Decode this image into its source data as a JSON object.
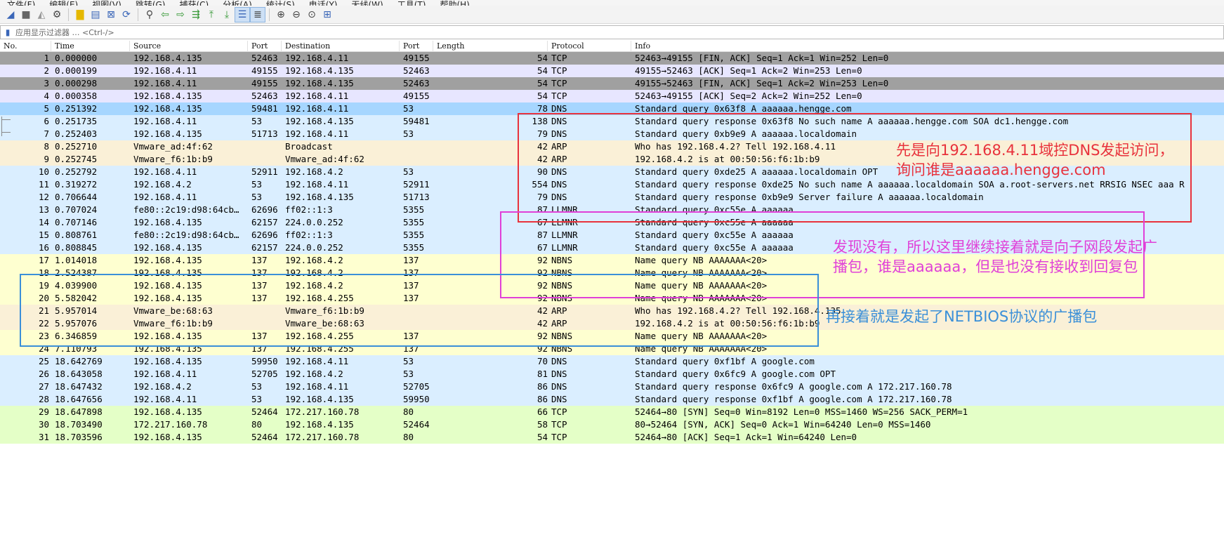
{
  "menubar": {
    "items": [
      "文件(F)",
      "编辑(E)",
      "视图(V)",
      "跳转(G)",
      "捕获(C)",
      "分析(A)",
      "统计(S)",
      "电话(Y)",
      "无线(W)",
      "工具(T)",
      "帮助(H)"
    ]
  },
  "toolbar": {
    "icons": [
      "shark-fin-start-icon",
      "stop-square-icon",
      "restart-fin-icon",
      "options-gear-icon",
      "open-folder-icon",
      "save-file-icon",
      "close-file-icon",
      "reload-icon",
      "find-packet-icon",
      "go-back-icon",
      "go-forward-icon",
      "go-to-packet-icon",
      "go-first-icon",
      "go-last-icon",
      "autoscroll-icon",
      "colorize-icon",
      "zoom-in-icon",
      "zoom-out-icon",
      "zoom-normal-icon",
      "resize-columns-icon"
    ]
  },
  "filter": {
    "placeholder": "应用显示过滤器 … <Ctrl-/>"
  },
  "columns": {
    "no": "No.",
    "time": "Time",
    "source": "Source",
    "sport": "Port",
    "destination": "Destination",
    "dport": "Port",
    "length_label": "Length",
    "protocol": "Protocol",
    "info": "Info"
  },
  "packets": [
    {
      "no": "1",
      "time": "0.000000",
      "src": "192.168.4.135",
      "sport": "52463",
      "dst": "192.168.4.11",
      "dport": "49155",
      "len": "54",
      "proto": "TCP",
      "info": "52463→49155 [FIN, ACK] Seq=1 Ack=1 Win=252 Len=0"
    },
    {
      "no": "2",
      "time": "0.000199",
      "src": "192.168.4.11",
      "sport": "49155",
      "dst": "192.168.4.135",
      "dport": "52463",
      "len": "54",
      "proto": "TCP",
      "info": "49155→52463 [ACK] Seq=1 Ack=2 Win=253 Len=0"
    },
    {
      "no": "3",
      "time": "0.000298",
      "src": "192.168.4.11",
      "sport": "49155",
      "dst": "192.168.4.135",
      "dport": "52463",
      "len": "54",
      "proto": "TCP",
      "info": "49155→52463 [FIN, ACK] Seq=1 Ack=2 Win=253 Len=0"
    },
    {
      "no": "4",
      "time": "0.000358",
      "src": "192.168.4.135",
      "sport": "52463",
      "dst": "192.168.4.11",
      "dport": "49155",
      "len": "54",
      "proto": "TCP",
      "info": "52463→49155 [ACK] Seq=2 Ack=2 Win=252 Len=0"
    },
    {
      "no": "5",
      "time": "0.251392",
      "src": "192.168.4.135",
      "sport": "59481",
      "dst": "192.168.4.11",
      "dport": "53",
      "len": "78",
      "proto": "DNS",
      "info": "Standard query 0x63f8 A aaaaaa.hengge.com"
    },
    {
      "no": "6",
      "time": "0.251735",
      "src": "192.168.4.11",
      "sport": "53",
      "dst": "192.168.4.135",
      "dport": "59481",
      "len": "138",
      "proto": "DNS",
      "info": "Standard query response 0x63f8 No such name A aaaaaa.hengge.com SOA dc1.hengge.com"
    },
    {
      "no": "7",
      "time": "0.252403",
      "src": "192.168.4.135",
      "sport": "51713",
      "dst": "192.168.4.11",
      "dport": "53",
      "len": "79",
      "proto": "DNS",
      "info": "Standard query 0xb9e9 A aaaaaa.localdomain"
    },
    {
      "no": "8",
      "time": "0.252710",
      "src": "Vmware_ad:4f:62",
      "sport": "",
      "dst": "Broadcast",
      "dport": "",
      "len": "42",
      "proto": "ARP",
      "info": "Who has 192.168.4.2? Tell 192.168.4.11"
    },
    {
      "no": "9",
      "time": "0.252745",
      "src": "Vmware_f6:1b:b9",
      "sport": "",
      "dst": "Vmware_ad:4f:62",
      "dport": "",
      "len": "42",
      "proto": "ARP",
      "info": "192.168.4.2 is at 00:50:56:f6:1b:b9"
    },
    {
      "no": "10",
      "time": "0.252792",
      "src": "192.168.4.11",
      "sport": "52911",
      "dst": "192.168.4.2",
      "dport": "53",
      "len": "90",
      "proto": "DNS",
      "info": "Standard query 0xde25 A aaaaaa.localdomain OPT"
    },
    {
      "no": "11",
      "time": "0.319272",
      "src": "192.168.4.2",
      "sport": "53",
      "dst": "192.168.4.11",
      "dport": "52911",
      "len": "554",
      "proto": "DNS",
      "info": "Standard query response 0xde25 No such name A aaaaaa.localdomain SOA a.root-servers.net RRSIG NSEC aaa R"
    },
    {
      "no": "12",
      "time": "0.706644",
      "src": "192.168.4.11",
      "sport": "53",
      "dst": "192.168.4.135",
      "dport": "51713",
      "len": "79",
      "proto": "DNS",
      "info": "Standard query response 0xb9e9 Server failure A aaaaaa.localdomain"
    },
    {
      "no": "13",
      "time": "0.707024",
      "src": "fe80::2c19:d98:64cb…",
      "sport": "62696",
      "dst": "ff02::1:3",
      "dport": "5355",
      "len": "87",
      "proto": "LLMNR",
      "info": "Standard query 0xc55e A aaaaaa"
    },
    {
      "no": "14",
      "time": "0.707146",
      "src": "192.168.4.135",
      "sport": "62157",
      "dst": "224.0.0.252",
      "dport": "5355",
      "len": "67",
      "proto": "LLMNR",
      "info": "Standard query 0xc55e A aaaaaa"
    },
    {
      "no": "15",
      "time": "0.808761",
      "src": "fe80::2c19:d98:64cb…",
      "sport": "62696",
      "dst": "ff02::1:3",
      "dport": "5355",
      "len": "87",
      "proto": "LLMNR",
      "info": "Standard query 0xc55e A aaaaaa"
    },
    {
      "no": "16",
      "time": "0.808845",
      "src": "192.168.4.135",
      "sport": "62157",
      "dst": "224.0.0.252",
      "dport": "5355",
      "len": "67",
      "proto": "LLMNR",
      "info": "Standard query 0xc55e A aaaaaa"
    },
    {
      "no": "17",
      "time": "1.014018",
      "src": "192.168.4.135",
      "sport": "137",
      "dst": "192.168.4.2",
      "dport": "137",
      "len": "92",
      "proto": "NBNS",
      "info": "Name query NB AAAAAAA<20>"
    },
    {
      "no": "18",
      "time": "2.524387",
      "src": "192.168.4.135",
      "sport": "137",
      "dst": "192.168.4.2",
      "dport": "137",
      "len": "92",
      "proto": "NBNS",
      "info": "Name query NB AAAAAAA<20>"
    },
    {
      "no": "19",
      "time": "4.039900",
      "src": "192.168.4.135",
      "sport": "137",
      "dst": "192.168.4.2",
      "dport": "137",
      "len": "92",
      "proto": "NBNS",
      "info": "Name query NB AAAAAAA<20>"
    },
    {
      "no": "20",
      "time": "5.582042",
      "src": "192.168.4.135",
      "sport": "137",
      "dst": "192.168.4.255",
      "dport": "137",
      "len": "92",
      "proto": "NBNS",
      "info": "Name query NB AAAAAAA<20>"
    },
    {
      "no": "21",
      "time": "5.957014",
      "src": "Vmware_be:68:63",
      "sport": "",
      "dst": "Vmware_f6:1b:b9",
      "dport": "",
      "len": "42",
      "proto": "ARP",
      "info": "Who has 192.168.4.2? Tell 192.168.4.135"
    },
    {
      "no": "22",
      "time": "5.957076",
      "src": "Vmware_f6:1b:b9",
      "sport": "",
      "dst": "Vmware_be:68:63",
      "dport": "",
      "len": "42",
      "proto": "ARP",
      "info": "192.168.4.2 is at 00:50:56:f6:1b:b9"
    },
    {
      "no": "23",
      "time": "6.346859",
      "src": "192.168.4.135",
      "sport": "137",
      "dst": "192.168.4.255",
      "dport": "137",
      "len": "92",
      "proto": "NBNS",
      "info": "Name query NB AAAAAAA<20>"
    },
    {
      "no": "24",
      "time": "7.110793",
      "src": "192.168.4.135",
      "sport": "137",
      "dst": "192.168.4.255",
      "dport": "137",
      "len": "92",
      "proto": "NBNS",
      "info": "Name query NB AAAAAAA<20>"
    },
    {
      "no": "25",
      "time": "18.642769",
      "src": "192.168.4.135",
      "sport": "59950",
      "dst": "192.168.4.11",
      "dport": "53",
      "len": "70",
      "proto": "DNS",
      "info": "Standard query 0xf1bf A google.com"
    },
    {
      "no": "26",
      "time": "18.643058",
      "src": "192.168.4.11",
      "sport": "52705",
      "dst": "192.168.4.2",
      "dport": "53",
      "len": "81",
      "proto": "DNS",
      "info": "Standard query 0x6fc9 A google.com OPT"
    },
    {
      "no": "27",
      "time": "18.647432",
      "src": "192.168.4.2",
      "sport": "53",
      "dst": "192.168.4.11",
      "dport": "52705",
      "len": "86",
      "proto": "DNS",
      "info": "Standard query response 0x6fc9 A google.com A 172.217.160.78"
    },
    {
      "no": "28",
      "time": "18.647656",
      "src": "192.168.4.11",
      "sport": "53",
      "dst": "192.168.4.135",
      "dport": "59950",
      "len": "86",
      "proto": "DNS",
      "info": "Standard query response 0xf1bf A google.com A 172.217.160.78"
    },
    {
      "no": "29",
      "time": "18.647898",
      "src": "192.168.4.135",
      "sport": "52464",
      "dst": "172.217.160.78",
      "dport": "80",
      "len": "66",
      "proto": "TCP",
      "info": "52464→80 [SYN] Seq=0 Win=8192 Len=0 MSS=1460 WS=256 SACK_PERM=1"
    },
    {
      "no": "30",
      "time": "18.703490",
      "src": "172.217.160.78",
      "sport": "80",
      "dst": "192.168.4.135",
      "dport": "52464",
      "len": "58",
      "proto": "TCP",
      "info": "80→52464 [SYN, ACK] Seq=0 Ack=1 Win=64240 Len=0 MSS=1460"
    },
    {
      "no": "31",
      "time": "18.703596",
      "src": "192.168.4.135",
      "sport": "52464",
      "dst": "172.217.160.78",
      "dport": "80",
      "len": "54",
      "proto": "TCP",
      "info": "52464→80 [ACK] Seq=1 Ack=1 Win=64240 Len=0"
    }
  ],
  "annotations": [
    {
      "color": "#e8323c",
      "lines": [
        "先是向192.168.4.11域控DNS发起访问，",
        "询问谁是aaaaaa.hengge.com"
      ]
    },
    {
      "color": "#e040d8",
      "lines": [
        "发现没有，所以这里继续接着就是向子网段发起广",
        "播包，谁是aaaaaa，但是也没有接收到回复包"
      ]
    },
    {
      "color": "#3a8fd8",
      "lines": [
        "再接着就是发起了NETBIOS协议的广播包"
      ]
    }
  ],
  "colors": {
    "tcp_dark": "#a0a0a0",
    "tcp": "#e7e6ff",
    "udp": "#daeeff",
    "arp": "#faf0d7",
    "nbns": "#feffd0",
    "tcp_http": "#e4ffc7",
    "selected": "#a6d6ff"
  }
}
